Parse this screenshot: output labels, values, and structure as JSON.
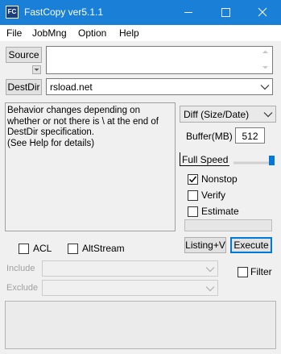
{
  "window": {
    "title": "FastCopy ver5.1.1",
    "icon_text": "FC"
  },
  "menu": [
    "File",
    "JobMng",
    "Option",
    "Help"
  ],
  "source": {
    "button_label": "Source",
    "value": ""
  },
  "destdir": {
    "button_label": "DestDir",
    "value": "rsload.net"
  },
  "info_text": "Behavior changes depending on whether or not there is \\ at the end of DestDir specification.\n(See Help for details)",
  "mode": {
    "selected": "Diff (Size/Date)"
  },
  "buffer": {
    "label": "Buffer(MB)",
    "value": "512"
  },
  "speed": {
    "label": "Full Speed",
    "level": 1.0
  },
  "options": {
    "nonstop": {
      "label": "Nonstop",
      "checked": true
    },
    "verify": {
      "label": "Verify",
      "checked": false
    },
    "estimate": {
      "label": "Estimate",
      "checked": false
    }
  },
  "buttons": {
    "listing": "Listing+V",
    "execute": "Execute"
  },
  "acl": {
    "label": "ACL",
    "checked": false
  },
  "altstream": {
    "label": "AltStream",
    "checked": false
  },
  "filter": {
    "label": "Filter",
    "checked": false
  },
  "include": {
    "label": "Include",
    "value": ""
  },
  "exclude": {
    "label": "Exclude",
    "value": ""
  },
  "status_text": "",
  "colors": {
    "titlebar": "#1a7fd6",
    "accent": "#0078d7"
  }
}
